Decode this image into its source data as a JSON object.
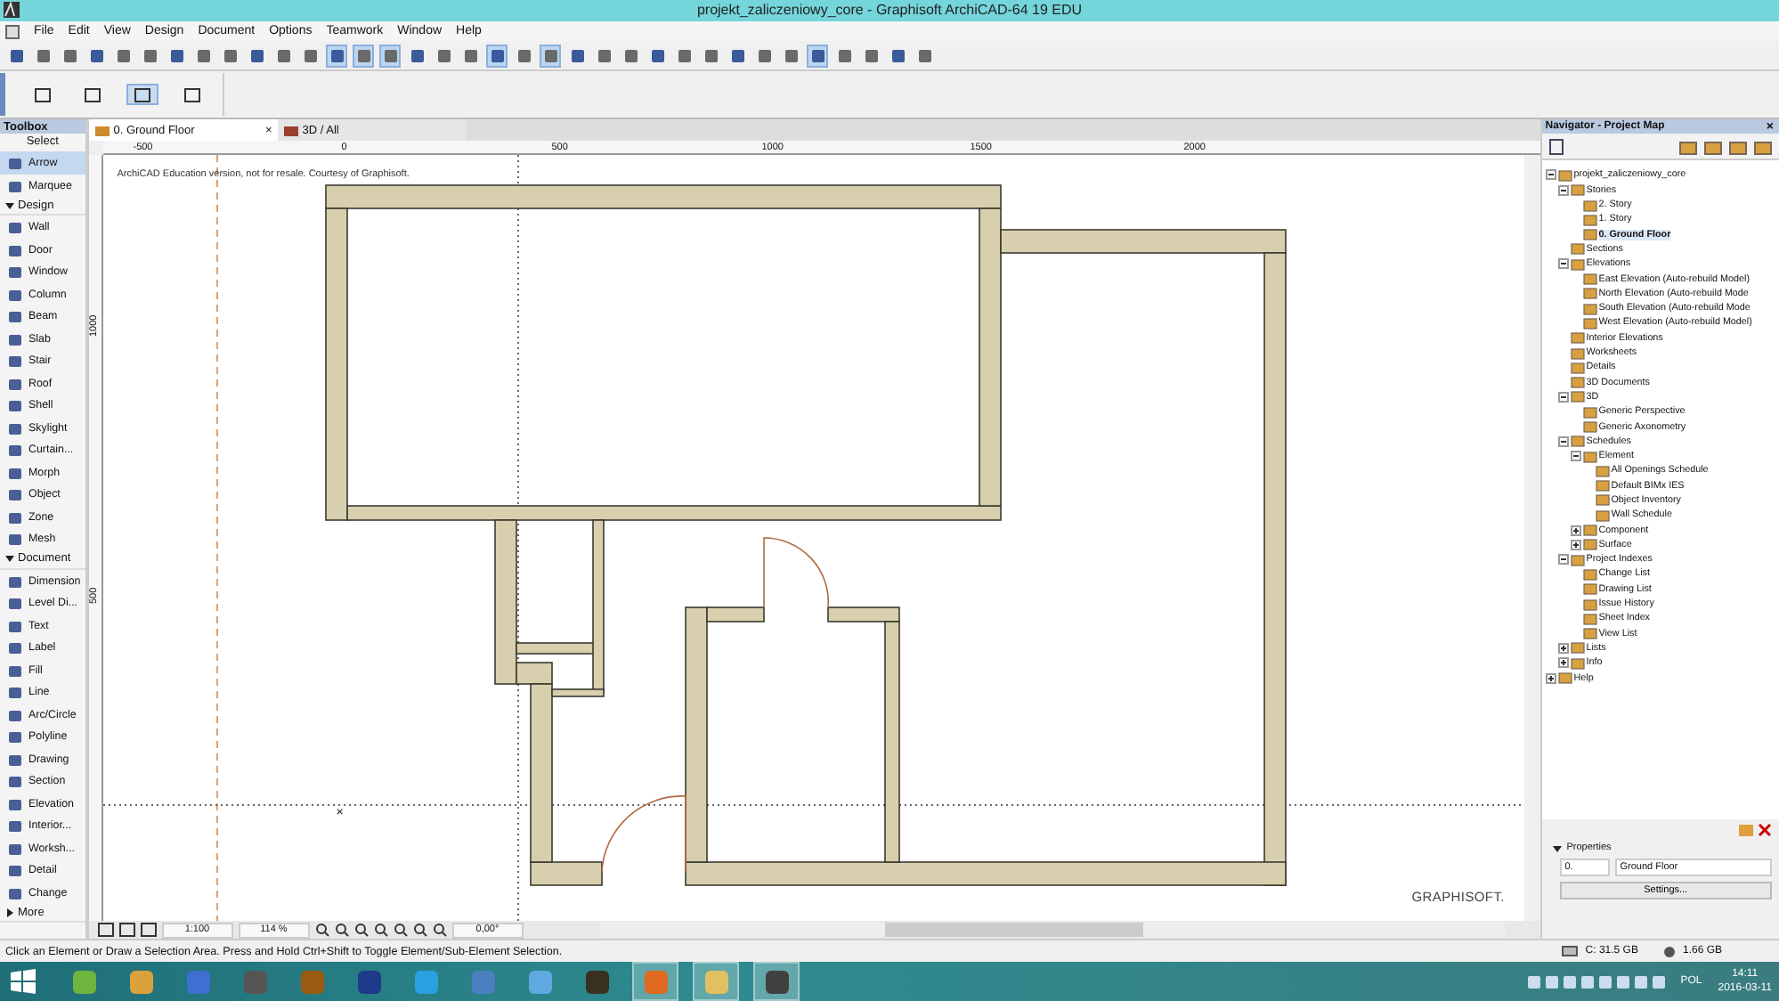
{
  "window": {
    "title": "projekt_zaliczeniowy_core - Graphisoft ArchiCAD-64 19 EDU"
  },
  "menu": [
    "File",
    "Edit",
    "View",
    "Design",
    "Document",
    "Options",
    "Teamwork",
    "Window",
    "Help"
  ],
  "toolbar": {
    "buttons": [
      {
        "selected": false
      },
      {
        "selected": false
      },
      {
        "selected": false
      },
      {
        "selected": false
      },
      {
        "selected": false
      },
      {
        "selected": false
      },
      {
        "selected": false
      },
      {
        "selected": false
      },
      {
        "selected": false
      },
      {
        "selected": false
      },
      {
        "selected": false
      },
      {
        "selected": false
      },
      {
        "selected": true
      },
      {
        "selected": true
      },
      {
        "selected": true
      },
      {
        "selected": false
      },
      {
        "selected": false
      },
      {
        "selected": false
      },
      {
        "selected": true
      },
      {
        "selected": false
      },
      {
        "selected": true
      },
      {
        "selected": false
      },
      {
        "selected": false
      },
      {
        "selected": false
      },
      {
        "selected": false
      },
      {
        "selected": false
      },
      {
        "selected": false
      },
      {
        "selected": false
      },
      {
        "selected": false
      },
      {
        "selected": false
      },
      {
        "selected": true
      },
      {
        "selected": false
      },
      {
        "selected": false
      },
      {
        "selected": false
      },
      {
        "selected": false
      }
    ]
  },
  "palette": {
    "buttons": [
      {
        "selected": false
      },
      {
        "selected": false
      },
      {
        "selected": true
      },
      {
        "selected": false
      }
    ]
  },
  "toolbox": {
    "title": "Toolbox",
    "sections": [
      {
        "kind": "label",
        "title": "Select",
        "tools": [
          {
            "label": "Arrow",
            "selected": true
          },
          {
            "label": "Marquee",
            "selected": false
          }
        ]
      },
      {
        "kind": "group",
        "title": "Design",
        "expanded": true,
        "tools": [
          {
            "label": "Wall",
            "selected": false
          },
          {
            "label": "Door",
            "selected": false
          },
          {
            "label": "Window",
            "selected": false
          },
          {
            "label": "Column",
            "selected": false
          },
          {
            "label": "Beam",
            "selected": false
          },
          {
            "label": "Slab",
            "selected": false
          },
          {
            "label": "Stair",
            "selected": false
          },
          {
            "label": "Roof",
            "selected": false
          },
          {
            "label": "Shell",
            "selected": false
          },
          {
            "label": "Skylight",
            "selected": false
          },
          {
            "label": "Curtain...",
            "selected": false
          },
          {
            "label": "Morph",
            "selected": false
          },
          {
            "label": "Object",
            "selected": false
          },
          {
            "label": "Zone",
            "selected": false
          },
          {
            "label": "Mesh",
            "selected": false
          }
        ]
      },
      {
        "kind": "group",
        "title": "Document",
        "expanded": true,
        "tools": [
          {
            "label": "Dimension",
            "selected": false
          },
          {
            "label": "Level Di...",
            "selected": false
          },
          {
            "label": "Text",
            "selected": false
          },
          {
            "label": "Label",
            "selected": false
          },
          {
            "label": "Fill",
            "selected": false
          },
          {
            "label": "Line",
            "selected": false
          },
          {
            "label": "Arc/Circle",
            "selected": false
          },
          {
            "label": "Polyline",
            "selected": false
          },
          {
            "label": "Drawing",
            "selected": false
          },
          {
            "label": "Section",
            "selected": false
          },
          {
            "label": "Elevation",
            "selected": false
          },
          {
            "label": "Interior...",
            "selected": false
          },
          {
            "label": "Worksh...",
            "selected": false
          },
          {
            "label": "Detail",
            "selected": false
          },
          {
            "label": "Change",
            "selected": false
          }
        ]
      },
      {
        "kind": "group",
        "title": "More",
        "expanded": false
      }
    ]
  },
  "tabs": [
    {
      "label": "0. Ground Floor",
      "selected": true,
      "close": "×"
    },
    {
      "label": "3D / All",
      "selected": false
    }
  ],
  "canvas": {
    "notice": "ArchiCAD Education version, not for resale. Courtesy of Graphisoft.",
    "logo": "GRAPHISOFT.",
    "marker": "×",
    "top_ruler": [
      "-500",
      "0",
      "500",
      "1000",
      "1500",
      "2000"
    ],
    "left_ruler": [
      "1000",
      "500"
    ]
  },
  "view_bar": {
    "scale": "1:100",
    "zoom": "114 %",
    "angle": "0,00°"
  },
  "navigator": {
    "title": "Navigator - Project Map",
    "close": "×",
    "tree": [
      {
        "label": "projekt_zaliczeniowy_core",
        "selected": false,
        "expanded": true,
        "children": [
          {
            "label": "Stories",
            "selected": false,
            "expanded": true,
            "children": [
              {
                "label": "2. Story",
                "selected": false
              },
              {
                "label": "1. Story",
                "selected": false
              },
              {
                "label": "0. Ground Floor",
                "selected": true
              }
            ]
          },
          {
            "label": "Sections",
            "selected": false
          },
          {
            "label": "Elevations",
            "selected": false,
            "expanded": true,
            "children": [
              {
                "label": "East Elevation (Auto-rebuild Model)",
                "selected": false
              },
              {
                "label": "North Elevation (Auto-rebuild Mode",
                "selected": false
              },
              {
                "label": "South Elevation (Auto-rebuild Mode",
                "selected": false
              },
              {
                "label": "West Elevation (Auto-rebuild Model)",
                "selected": false
              }
            ]
          },
          {
            "label": "Interior Elevations",
            "selected": false
          },
          {
            "label": "Worksheets",
            "selected": false
          },
          {
            "label": "Details",
            "selected": false
          },
          {
            "label": "3D Documents",
            "selected": false
          },
          {
            "label": "3D",
            "selected": false,
            "expanded": true,
            "children": [
              {
                "label": "Generic Perspective",
                "selected": false
              },
              {
                "label": "Generic Axonometry",
                "selected": false
              }
            ]
          },
          {
            "label": "Schedules",
            "selected": false,
            "expanded": true,
            "children": [
              {
                "label": "Element",
                "selected": false,
                "expanded": true,
                "children": [
                  {
                    "label": "All Openings Schedule",
                    "selected": false
                  },
                  {
                    "label": "Default BIMx IES",
                    "selected": false
                  },
                  {
                    "label": "Object Inventory",
                    "selected": false
                  },
                  {
                    "label": "Wall Schedule",
                    "selected": false
                  }
                ]
              },
              {
                "label": "Component",
                "selected": false,
                "expanded": false
              },
              {
                "label": "Surface",
                "selected": false,
                "expanded": false
              }
            ]
          },
          {
            "label": "Project Indexes",
            "selected": false,
            "expanded": true,
            "children": [
              {
                "label": "Change List",
                "selected": false
              },
              {
                "label": "Drawing List",
                "selected": false
              },
              {
                "label": "Issue History",
                "selected": false
              },
              {
                "label": "Sheet Index",
                "selected": false
              },
              {
                "label": "View List",
                "selected": false
              }
            ]
          },
          {
            "label": "Lists",
            "selected": false,
            "expanded": false
          },
          {
            "label": "Info",
            "selected": false,
            "expanded": false
          }
        ]
      },
      {
        "label": "Help",
        "selected": false,
        "expanded": false
      }
    ],
    "properties": {
      "title": "Properties",
      "expanded": true,
      "number": "0.",
      "name": "Ground Floor",
      "button": "Settings..."
    }
  },
  "status_bar": {
    "message": "Click an Element or Draw a Selection Area. Press and Hold Ctrl+Shift to Toggle Element/Sub-Element Selection.",
    "disk": "C: 31.5 GB",
    "memory": "1.66 GB"
  },
  "taskbar": {
    "apps": [
      {
        "color": "#6fb43f",
        "selected": false
      },
      {
        "color": "#d9a23a",
        "selected": false
      },
      {
        "color": "#3f6fd0",
        "selected": false
      },
      {
        "color": "#555555",
        "selected": false
      },
      {
        "color": "#9a5a10",
        "selected": false
      },
      {
        "color": "#1d3b8a",
        "selected": false
      },
      {
        "color": "#2aa0e0",
        "selected": false
      },
      {
        "color": "#4a7fc0",
        "selected": false
      },
      {
        "color": "#60a8e0",
        "selected": false
      },
      {
        "color": "#3a3020",
        "selected": false
      },
      {
        "color": "#e06a20",
        "selected": true
      },
      {
        "color": "#e0c060",
        "selected": true
      },
      {
        "color": "#404040",
        "selected": true
      }
    ],
    "language": "POL",
    "time": "14:11",
    "date": "2016-03-11"
  }
}
